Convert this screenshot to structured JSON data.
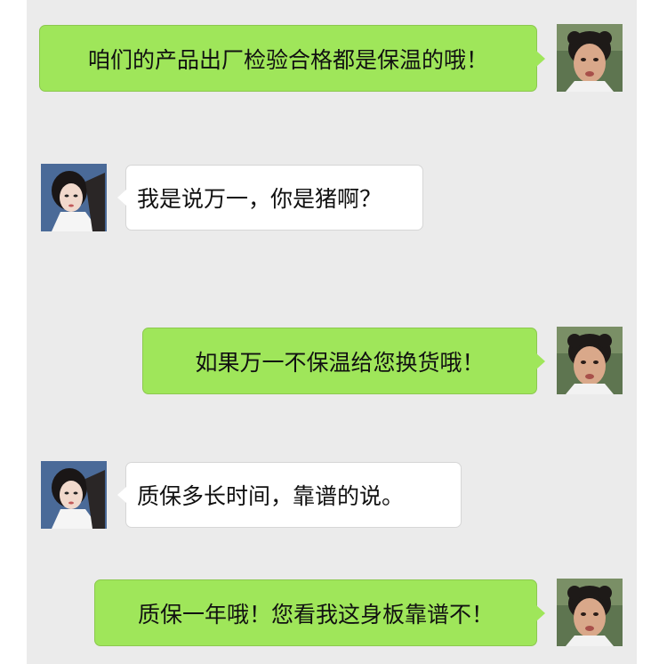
{
  "messages": [
    {
      "sender": "self",
      "text": "咱们的产品出厂检验合格都是保温的哦！"
    },
    {
      "sender": "other",
      "text": "我是说万一，你是猪啊？"
    },
    {
      "sender": "self",
      "text": "如果万一不保温给您换货哦！"
    },
    {
      "sender": "other",
      "text": "质保多长时间，靠谱的说。"
    },
    {
      "sender": "self",
      "text": "质保一年哦！您看我这身板靠谱不！"
    }
  ],
  "colors": {
    "chat_background": "#ebebeb",
    "self_bubble": "#9fe65a",
    "other_bubble": "#ffffff"
  }
}
